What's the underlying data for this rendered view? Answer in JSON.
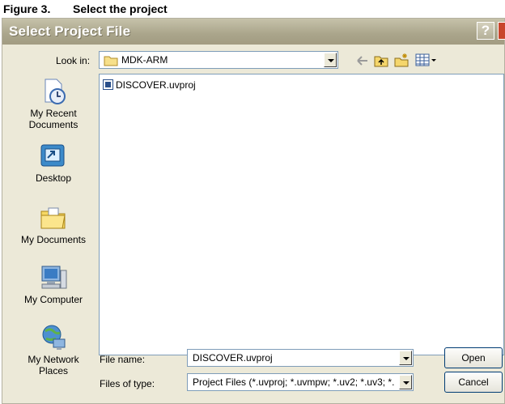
{
  "figure": {
    "number": "Figure 3.",
    "caption": "Select the project"
  },
  "window": {
    "title": "Select Project File",
    "help_label": "?"
  },
  "look_in": {
    "label": "Look in:",
    "value": "MDK-ARM"
  },
  "places": [
    {
      "label": "My Recent Documents",
      "icon": "recent-documents-icon"
    },
    {
      "label": "Desktop",
      "icon": "desktop-icon"
    },
    {
      "label": "My Documents",
      "icon": "my-documents-icon"
    },
    {
      "label": "My Computer",
      "icon": "my-computer-icon"
    },
    {
      "label": "My Network Places",
      "icon": "network-places-icon"
    }
  ],
  "files": [
    {
      "name": "DISCOVER.uvproj",
      "icon": "uvproj-file-icon"
    }
  ],
  "file_name": {
    "label": "File name:",
    "value": "DISCOVER.uvproj"
  },
  "file_type": {
    "label": "Files of type:",
    "value": "Project Files (*.uvproj; *.uvmpw; *.uv2; *.uv3; *."
  },
  "buttons": {
    "open": "Open",
    "cancel": "Cancel"
  }
}
